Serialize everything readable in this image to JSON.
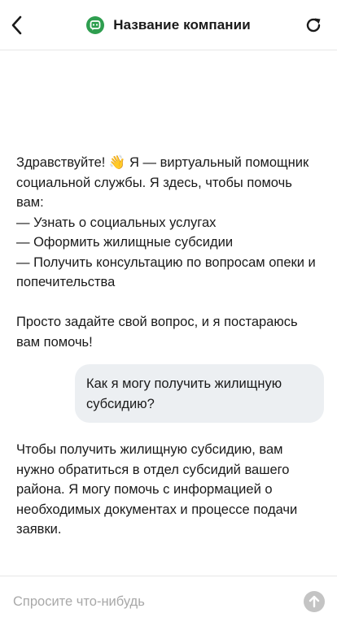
{
  "header": {
    "back_icon": "chevron-left-icon",
    "logo_icon": "chat-bot-logo",
    "title": "Название компании",
    "reload_icon": "refresh-icon",
    "brand_color": "#2e9e4f"
  },
  "messages": {
    "greeting": {
      "line1": "Здравствуйте! 👋 Я — виртуальный помощник социальной службы. Я здесь, чтобы помочь вам:",
      "item1": "— Узнать о социальных услугах",
      "item2": "— Оформить жилищные субсидии",
      "item3": "— Получить консультацию по вопросам опеки и попечительства",
      "line2": "Просто задайте свой вопрос, и я постараюсь вам помочь!"
    },
    "user_question": "Как я могу получить жилищную субсидию?",
    "assistant_answer": "Чтобы получить жилищную субсидию, вам нужно обратиться в отдел субсидий вашего района. Я могу помочь с информацией о необходимых документах и процессе подачи заявки."
  },
  "composer": {
    "placeholder": "Спросите что-нибудь",
    "value": "",
    "send_icon": "arrow-up-icon"
  }
}
